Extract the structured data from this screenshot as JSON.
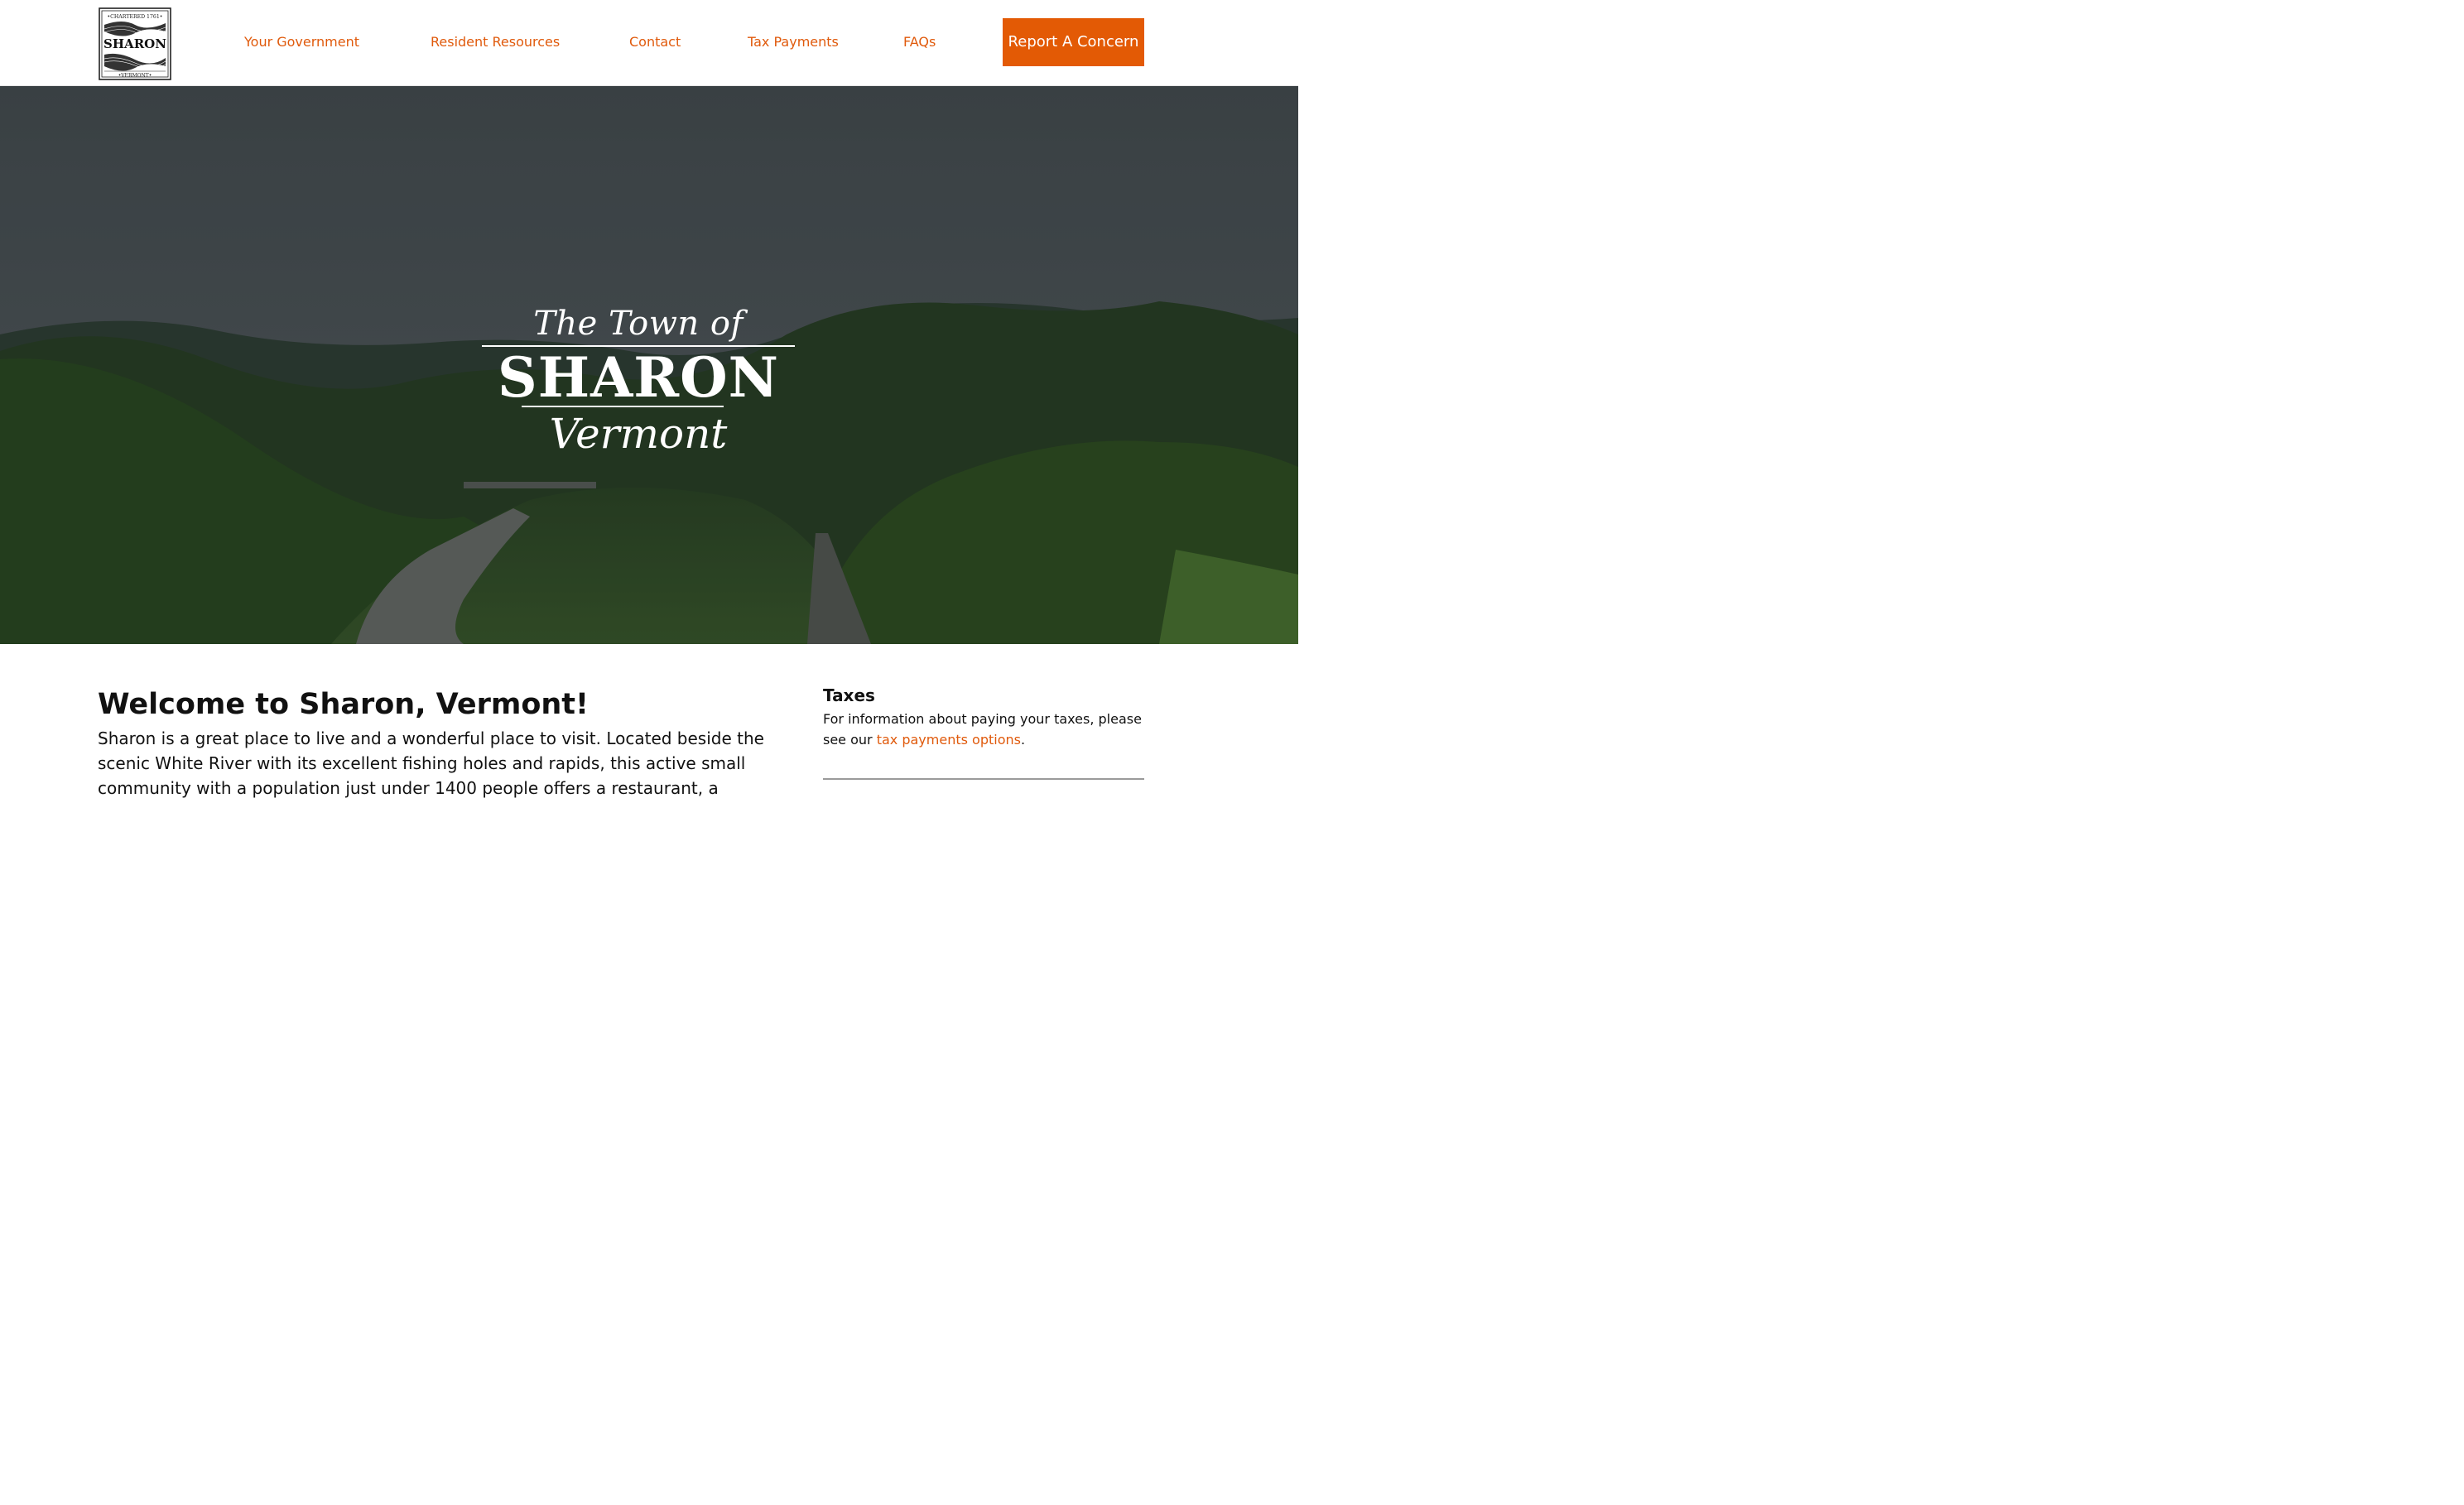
{
  "header": {
    "logo": {
      "top_text": "•CHARTERED 1761•",
      "name": "SHARON",
      "bottom_text": "•VERMONT•"
    },
    "nav": [
      {
        "label": "Your Government"
      },
      {
        "label": "Resident Resources"
      },
      {
        "label": "Contact"
      },
      {
        "label": "Tax Payments"
      },
      {
        "label": "FAQs"
      }
    ],
    "cta_label": "Report A Concern"
  },
  "hero": {
    "line1": "The Town of",
    "line2": "SHARON",
    "line3": "Vermont"
  },
  "main": {
    "title": "Welcome to Sharon, Vermont!",
    "body": "Sharon is a great place to live and a wonderful place to visit. Located beside the scenic White River with its excellent fishing holes and rapids, this active small community with a population just under 1400 people offers a restaurant, a"
  },
  "sidebar": {
    "heading": "Taxes",
    "text_before": "For information about paying your taxes, please see our ",
    "link_label": "tax payments options",
    "text_after": "."
  },
  "colors": {
    "accent": "#e35a05",
    "link": "#e05a0c",
    "text": "#111111",
    "divider": "#9a9a9a"
  }
}
